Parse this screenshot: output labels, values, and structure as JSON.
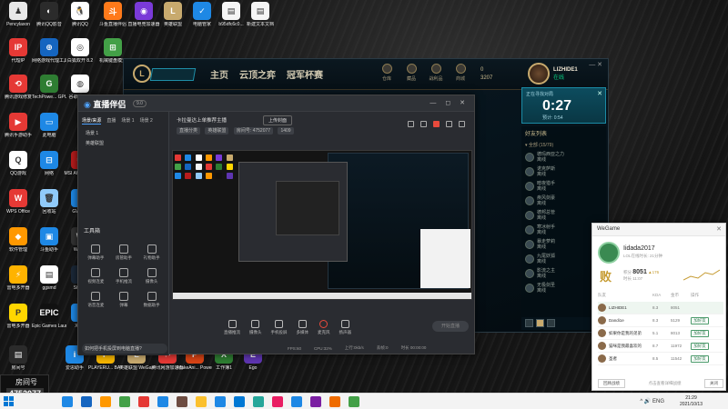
{
  "desktop_icons": [
    {
      "label": "Pencylaxon",
      "color": "#e8e8e8",
      "glyph": "♟"
    },
    {
      "label": "腾讯QQ影音",
      "color": "#2b2b2b",
      "glyph": "◐"
    },
    {
      "label": "腾讯QQ",
      "color": "#ffffff",
      "glyph": "🐧"
    },
    {
      "label": "斗鱼直播伴侣",
      "color": "#ff7a1a",
      "glyph": "斗"
    },
    {
      "label": "直播电竞加速器",
      "color": "#7a3ad8",
      "glyph": "◉"
    },
    {
      "label": "英雄联盟",
      "color": "#c8aa6e",
      "glyph": "L"
    },
    {
      "label": "电脑管家",
      "color": "#1e88e5",
      "glyph": "✓"
    },
    {
      "label": "b95dfc6c0...",
      "color": "#f5f5f5",
      "glyph": "▤"
    },
    {
      "label": "新建文本文档",
      "color": "#f5f5f5",
      "glyph": "▤"
    },
    {
      "label": "代理IP",
      "color": "#e53935",
      "glyph": "IP"
    },
    {
      "label": "网络游戏代理工具",
      "color": "#1565c0",
      "glyph": "⊕"
    },
    {
      "label": "白狐双开 8.2",
      "color": "#ffffff",
      "glyph": "◎"
    },
    {
      "label": "机械键盘模式",
      "color": "#43a047",
      "glyph": "⊞"
    },
    {
      "label": "腾讯游戏修复",
      "color": "#e53935",
      "glyph": "⟲"
    },
    {
      "label": "TechPowe... GPU-Z",
      "color": "#2e7d32",
      "glyph": "G"
    },
    {
      "label": "谷歌浏览器",
      "color": "#ffffff",
      "glyph": "◍"
    },
    {
      "label": "腾讯手游助手",
      "color": "#e53935",
      "glyph": "▶"
    },
    {
      "label": "此电脑",
      "color": "#1e88e5",
      "glyph": "▭"
    },
    {
      "label": "QQ游戏",
      "color": "#ffffff",
      "glyph": "Q"
    },
    {
      "label": "网络",
      "color": "#1e88e5",
      "glyph": "⊟"
    },
    {
      "label": "MSI Afterburner",
      "color": "#b71c1c",
      "glyph": "✈"
    },
    {
      "label": "WPS Office",
      "color": "#e53935",
      "glyph": "W"
    },
    {
      "label": "回收站",
      "color": "#90caf9",
      "glyph": "🗑"
    },
    {
      "label": "GW-5...",
      "color": "#1e88e5",
      "glyph": "⌂"
    },
    {
      "label": "软件管理",
      "color": "#ff9800",
      "glyph": "◆"
    },
    {
      "label": "斗鱼助手",
      "color": "#1e88e5",
      "glyph": "▣"
    },
    {
      "label": "Watt...",
      "color": "#333333",
      "glyph": "W"
    },
    {
      "label": "雷电多开器",
      "color": "#ffb300",
      "glyph": "⚡"
    },
    {
      "label": "ggsmd",
      "color": "#ffffff",
      "glyph": "▤"
    },
    {
      "label": "Steam",
      "color": "#1b2838",
      "glyph": "S"
    },
    {
      "label": "雷电多开器",
      "color": "#ffd600",
      "glyph": "P"
    },
    {
      "label": "Epic Games Launcher",
      "color": "#111111",
      "glyph": "EPIC"
    },
    {
      "label": "Xbox",
      "color": "#1e88e5",
      "glyph": "X"
    },
    {
      "label": "房间号",
      "color": "#2b2b2b",
      "glyph": "▤"
    },
    {
      "label": "爱思助手",
      "color": "#1e88e5",
      "glyph": "i"
    },
    {
      "label": "PLAYERU... BATTLEG...",
      "color": "#f5b400",
      "glyph": "P"
    },
    {
      "label": "英雄联盟 WeGame版",
      "color": "#c8aa6e",
      "glyph": "L"
    },
    {
      "label": "腾讯网游加速器",
      "color": "#e53935",
      "glyph": "⚑"
    },
    {
      "label": "MakeAni... PowerPoi...",
      "color": "#d84315",
      "glyph": "P"
    },
    {
      "label": "工作簿1",
      "color": "#2e7d32",
      "glyph": "X"
    },
    {
      "label": "Ego",
      "color": "#5e35b1",
      "glyph": "E"
    }
  ],
  "lol_client": {
    "logo": "L",
    "nav": [
      "主页",
      "云顶之弈",
      "冠军杯赛"
    ],
    "icons": [
      "仓库",
      "藏品",
      "战利品",
      "商城"
    ],
    "currency": {
      "rp": "0",
      "be": "3207"
    },
    "username": "LIZHIDE1",
    "status": "在线",
    "winctl": "— ✕",
    "queue": {
      "label": "正在寻找对局",
      "time": "0:27",
      "sub": "预计: 0:54",
      "close": "✕"
    },
    "friends_title": "好友列表",
    "friends_group": "▾ 全部 (15/79)",
    "friends": [
      "德玛西亚之力",
      "诺克萨斯",
      "暗夜猎手",
      "疾风剑豪",
      "德邦总管",
      "寒冰射手",
      "暴走萝莉",
      "九尾妖狐",
      "影流之主",
      "无极剑圣"
    ],
    "friend_status": "离线"
  },
  "streamer": {
    "logo": "直播伴侣",
    "version": "9.0",
    "controls": "— ◻ ✕",
    "tabs": [
      "场景/来源",
      "直播",
      "场景 1",
      "场景 2"
    ],
    "scenes": [
      "场景 1",
      "英雄联盟"
    ],
    "tools_title": "工具箱",
    "tools": [
      "弹幕助手",
      "房管助手",
      "礼物助手",
      "视频连麦",
      "手机推流",
      "摄像头",
      "语音连麦",
      "弹幕",
      "数据助手"
    ],
    "tip": "如何把手机投屏到电脑直播?",
    "room_title": "卡拉曼达上单推荐主播",
    "room_button": "上传封面",
    "room_meta": [
      "直播分类",
      "英雄联盟",
      "房间号: 4752077",
      "1409"
    ],
    "bottom_tools": [
      "直播推流",
      "摄像头",
      "手机投屏",
      "多媒体",
      "麦克风",
      "扬声器"
    ],
    "live_button": "开始直播",
    "status": [
      "FPS:60",
      "CPU:32%",
      "上行:0kb/s",
      "丢帧:0",
      "时长 00:00:00"
    ]
  },
  "wegame": {
    "title": "WeGame",
    "close": "✕",
    "name": "Iidada2017",
    "sub": "LOL在线时长: 21分钟",
    "result": "败",
    "score_label": "积分",
    "score": "8051",
    "score_delta": "▲176",
    "score_sub": "时长 11:07",
    "columns": [
      "队友",
      "KDA",
      "金币",
      "操作"
    ],
    "players": [
      {
        "name": "LIZHIDE1",
        "kda": "8.3",
        "gold": "8051",
        "btn": "",
        "me": true
      },
      {
        "name": "Dandi1e",
        "kda": "8.3",
        "gold": "5129",
        "btn": "加好友",
        "me": false
      },
      {
        "name": "如果你是我的弟弟",
        "kda": "5.1",
        "gold": "8013",
        "btn": "加好友",
        "me": false
      },
      {
        "name": "猫咪是我最喜欢的",
        "kda": "8.7",
        "gold": "11972",
        "btn": "加好友",
        "me": false
      },
      {
        "name": "圣者",
        "kda": "8.5",
        "gold": "11542",
        "btn": "加好友",
        "me": false
      }
    ],
    "foot_button": "回顾战绩",
    "foot_text": "点击查看详细战绩",
    "foot_close": "关闭"
  },
  "taskbar": {
    "icon_colors": [
      "#1e88e5",
      "#1565c0",
      "#ff9800",
      "#43a047",
      "#e53935",
      "#1e88e5",
      "#6d4c41",
      "#fbc02d",
      "#1e88e5",
      "#0078d4",
      "#26a69a",
      "#e91e63",
      "#1e88e5",
      "#7b1fa2",
      "#ef6c00",
      "#43a047"
    ],
    "tray": "^ 🔊 ENG",
    "time": "21:29",
    "date": "2021/10/13"
  },
  "cam": {
    "label": "房间号",
    "room": "4752077"
  }
}
